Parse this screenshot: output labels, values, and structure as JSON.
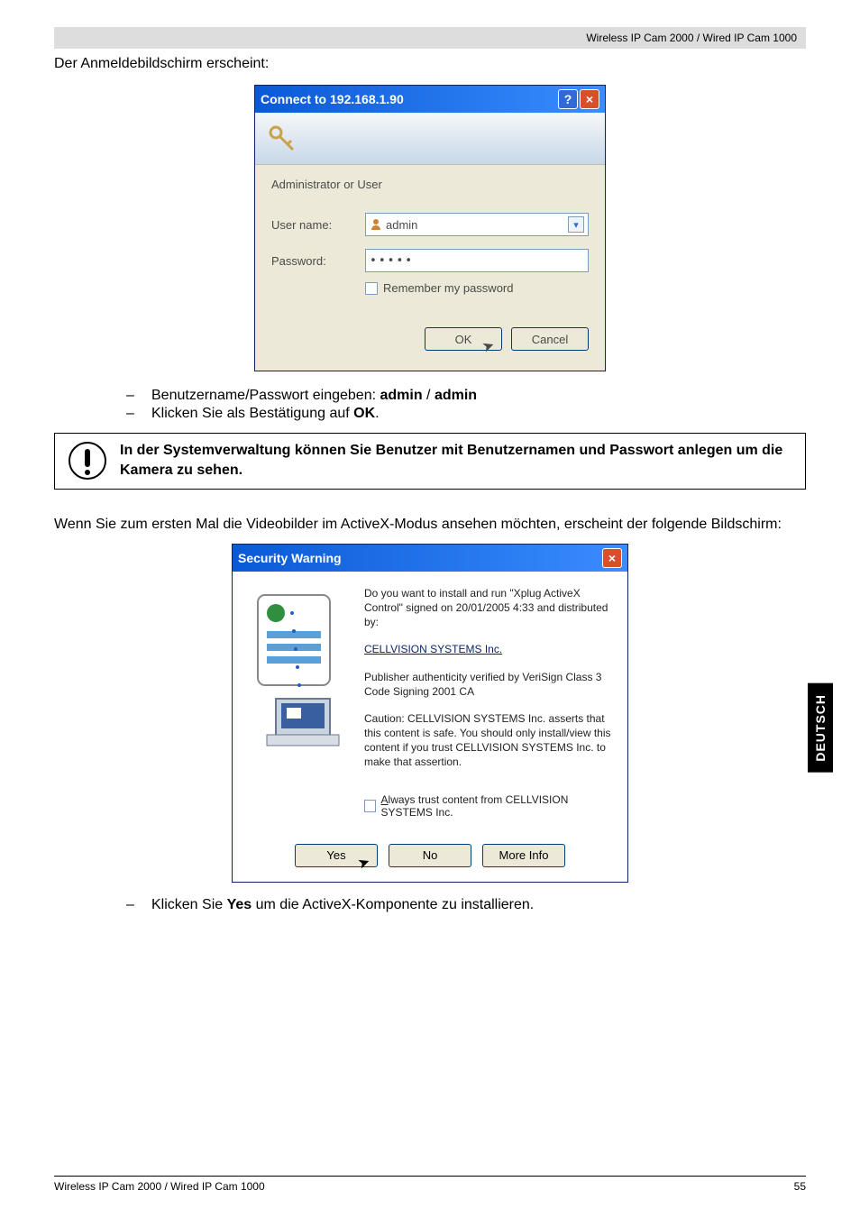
{
  "header": {
    "product": "Wireless IP Cam 2000 / Wired IP Cam 1000"
  },
  "intro": "Der Anmeldebildschirm erscheint:",
  "dialog1": {
    "title": "Connect to 192.168.1.90",
    "realm": "Administrator or User",
    "userLabel": "User name:",
    "userValue": "admin",
    "passLabel": "Password:",
    "passValue": "•••••",
    "remember": "Remember my password",
    "ok": "OK",
    "cancel": "Cancel"
  },
  "bullets1": [
    {
      "prefix": "Benutzername/Passwort eingeben: ",
      "bold1": "admin",
      "mid": " / ",
      "bold2": "admin"
    },
    {
      "prefix": "Klicken Sie als Bestätigung auf ",
      "bold1": "OK",
      "mid": ".",
      "bold2": ""
    }
  ],
  "note": "In der Systemverwaltung können Sie Benutzer mit Benutzernamen und Passwort anlegen um die Kamera zu sehen.",
  "body2": "Wenn Sie zum ersten Mal die Videobilder im ActiveX-Modus ansehen möchten, erscheint der folgende Bildschirm:",
  "dialog2": {
    "title": "Security Warning",
    "p1": "Do you want to install and run \"Xplug ActiveX Control\" signed on 20/01/2005 4:33 and distributed by:",
    "link": "CELLVISION SYSTEMS Inc.",
    "p2": "Publisher authenticity verified by VeriSign Class 3 Code Signing 2001 CA",
    "p3": "Caution: CELLVISION SYSTEMS Inc. asserts that this content is safe.  You should only install/view this content if you trust CELLVISION SYSTEMS Inc. to make that assertion.",
    "trust": "Always trust content from CELLVISION SYSTEMS Inc.",
    "yes": "Yes",
    "no": "No",
    "more": "More Info"
  },
  "bullets2": [
    {
      "prefix": "Klicken Sie ",
      "bold1": "Yes",
      "mid": " um die ActiveX-Komponente zu installieren.",
      "bold2": ""
    }
  ],
  "sidetab": "DEUTSCH",
  "footer": {
    "left": "Wireless IP Cam 2000 / Wired IP Cam 1000",
    "right": "55"
  }
}
